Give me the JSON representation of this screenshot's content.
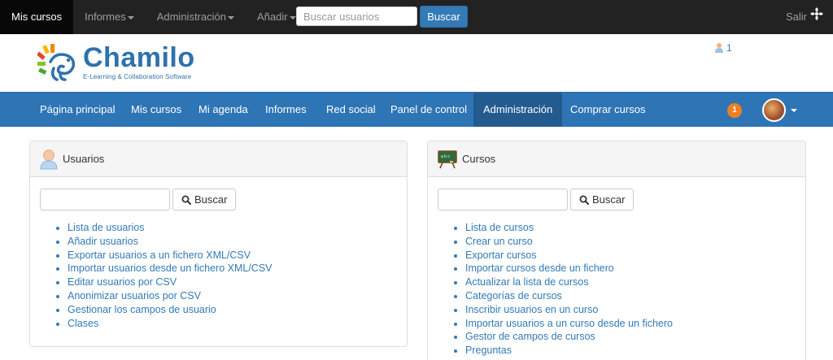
{
  "topbar": {
    "items": [
      {
        "label": "Mis cursos",
        "active": true
      },
      {
        "label": "Informes",
        "dropdown": true
      },
      {
        "label": "Administración",
        "dropdown": true
      },
      {
        "label": "Añadir",
        "dropdown": true
      }
    ],
    "search_placeholder": "Buscar usuarios",
    "search_button": "Buscar",
    "logout_label": "Salir",
    "logout_icon": "logout-icon"
  },
  "header": {
    "logo_name": "Chamilo",
    "logo_tagline": "E-Learning & Collaboration Software",
    "online_users_count": "1",
    "online_icon": "user-icon"
  },
  "mainnav": {
    "items": [
      {
        "label": "Página principal"
      },
      {
        "label": "Mis cursos"
      },
      {
        "label": "Mi agenda"
      },
      {
        "label": "Informes"
      },
      {
        "label": "Red social"
      },
      {
        "label": "Panel de control"
      },
      {
        "label": "Administración",
        "active": true
      },
      {
        "label": "Comprar cursos"
      }
    ],
    "notifications_count": "1"
  },
  "panels": {
    "users": {
      "title": "Usuarios",
      "icon": "user-icon",
      "search_button": "Buscar",
      "links": [
        "Lista de usuarios",
        "Añadir usuarios",
        "Exportar usuarios a un fichero XML/CSV",
        "Importar usuarios desde un fichero XML/CSV",
        "Editar usuarios por CSV",
        "Anonimizar usuarios por CSV",
        "Gestionar los campos de usuario",
        "Clases"
      ]
    },
    "courses": {
      "title": "Cursos",
      "icon": "blackboard-icon",
      "search_button": "Buscar",
      "links": [
        "Lista de cursos",
        "Crear un curso",
        "Exportar cursos",
        "Importar cursos desde un fichero",
        "Actualizar la lista de cursos",
        "Categorías de cursos",
        "Inscribir usuarios en un curso",
        "Importar usuarios a un curso desde un fichero",
        "Gestor de campos de cursos",
        "Preguntas"
      ]
    }
  },
  "colors": {
    "topbar": "#222222",
    "mainnav": "#2e75b6",
    "mainnav_active": "#245b8f",
    "link": "#337ab7",
    "badge": "#f0801f",
    "search_button": "#337ab7"
  }
}
